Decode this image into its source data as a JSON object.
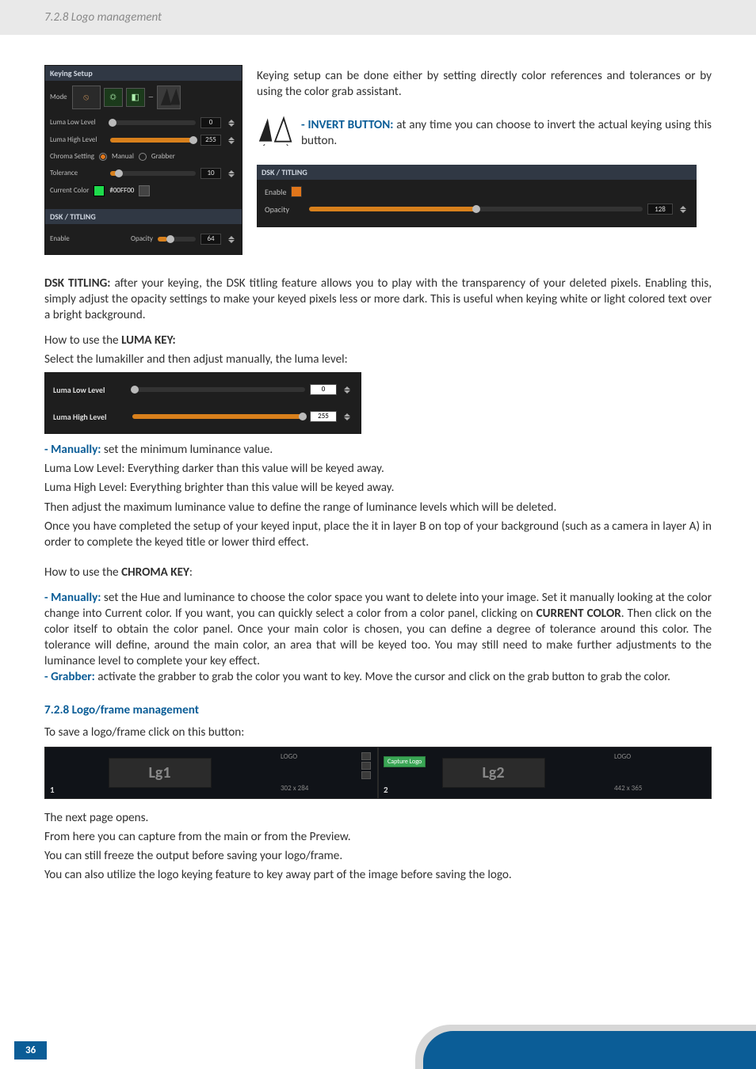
{
  "header": {
    "breadcrumb": "7.2.8 Logo management"
  },
  "page_number": "36",
  "keying_panel": {
    "title": "Keying Setup",
    "mode_label": "Mode",
    "luma_low_label": "Luma Low Level",
    "luma_low_value": "0",
    "luma_high_label": "Luma High Level",
    "luma_high_value": "255",
    "chroma_setting_label": "Chroma Setting",
    "manual_label": "Manual",
    "grabber_label": "Grabber",
    "tolerance_label": "Tolerance",
    "tolerance_value": "10",
    "current_color_label": "Current Color",
    "current_color_hex": "#00FF00",
    "dsk_title": "DSK / TITLING",
    "enable_label": "Enable",
    "enable_opacity_label": "Opacity",
    "enable_opacity_value": "64"
  },
  "intro_para": "Keying setup can be done either by setting directly color references and tolerances or by using the color grab assistant.",
  "invert_label": "- INVERT BUTTON:",
  "invert_desc": " at any time you can choose to invert the actual keying using this button.",
  "dsk_wide": {
    "title": "DSK / TITLING",
    "enable_label": "Enable",
    "opacity_label": "Opacity",
    "opacity_value": "128"
  },
  "dsk_titling_head": "DSK TITLING:",
  "dsk_titling_body": " after your keying, the DSK titling feature allows you to play with the transparency of your deleted pixels. Enabling this, simply adjust the opacity settings to make your keyed pixels less or more dark. This is useful when keying white or light colored text over a bright background.",
  "luma_intro_1": "How to use the ",
  "luma_intro_2": "LUMA KEY:",
  "luma_intro_3": "Select the lumakiller and then adjust manually, the luma level:",
  "luma_panel": {
    "low_label": "Luma Low Level",
    "low_value": "0",
    "high_label": "Luma High Level",
    "high_value": "255"
  },
  "manually_label": "- Manually:",
  "manually_body": " set the minimum luminance value.",
  "luma_low_line": "Luma Low Level:  Everything darker than this value will be keyed away.",
  "luma_high_line": "Luma High Level: Everything brighter than this value will be keyed away.",
  "luma_then": "Then adjust the maximum luminance value to define the range of luminance levels which will be deleted.",
  "luma_once": "Once you have completed the setup of your keyed input, place the it in layer B on top of your background (such as a camera in layer A) in order to complete the keyed title or lower third effect.",
  "chroma_intro_1": "How to use the ",
  "chroma_intro_2": "CHROMA KEY",
  "chroma_intro_3": ":",
  "chroma_manual_label": "- Manually:",
  "chroma_manual_body_1": " set the Hue and luminance to choose the color space you want to delete into your image. Set it manually looking at the color change into Current color. If you want, you can quickly select a color from a color panel, clicking on ",
  "chroma_manual_bold": "CURRENT COLOR",
  "chroma_manual_body_2": ". Then click on the color itself to obtain the color panel. Once your main color is chosen, you can define a degree of tolerance around this color. The tolerance will define, around the main color, an area that will be keyed too. You may still need to make further adjustments to the luminance level to complete your key effect.",
  "grabber_label_b": "- Grabber:",
  "grabber_body": " activate the grabber to grab the color you want to key. Move the cursor and click on the grab button to grab the color.",
  "section_728": "7.2.8 Logo/frame management",
  "logo_intro": "To save a logo/frame click on this button:",
  "logo_strip": {
    "lg1": "Lg1",
    "lg2": "Lg2",
    "logo_label": "LOGO",
    "size1": "302 x 284",
    "size2": "442 x 365",
    "capture": "Capture Logo",
    "n1": "1",
    "n2": "2"
  },
  "closing_1": "The next page opens.",
  "closing_2": "From here you can capture from the main or from the Preview.",
  "closing_3": "You can still freeze the output before saving your logo/frame.",
  "closing_4": "You can also utilize the logo keying feature to key away part of the image before saving the logo."
}
